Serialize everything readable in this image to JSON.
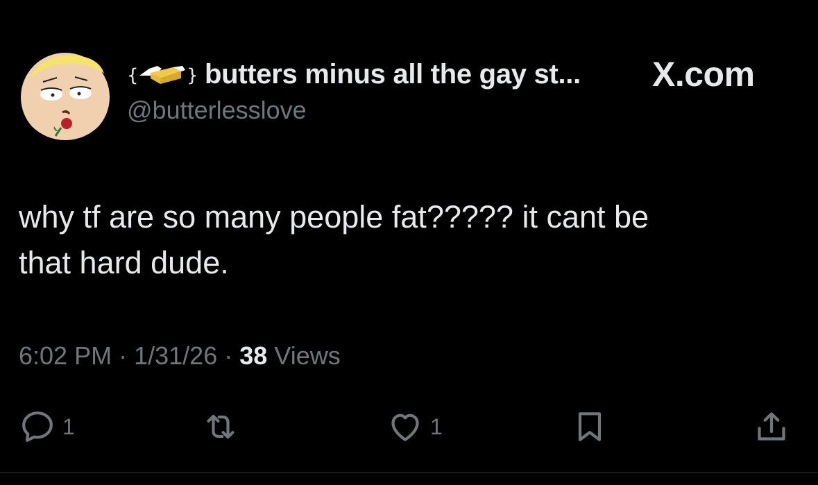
{
  "tweet": {
    "display_name": "butters minus all the gay st...",
    "handle": "@butterlesslove",
    "brand": "X.com",
    "text_line1": "why tf are so many people fat????? it cant be",
    "text_line2": "that hard dude.",
    "time": "6:02 PM",
    "separator": "·",
    "date": "1/31/26",
    "views_count": "38",
    "views_label": "Views"
  },
  "actions": {
    "reply_count": "1",
    "like_count": "1"
  },
  "icons": [
    "reply-icon",
    "repost-icon",
    "like-icon",
    "bookmark-icon",
    "share-icon"
  ],
  "colors": {
    "background": "#000000",
    "text": "#e7e9ea",
    "secondary": "#71767b"
  }
}
